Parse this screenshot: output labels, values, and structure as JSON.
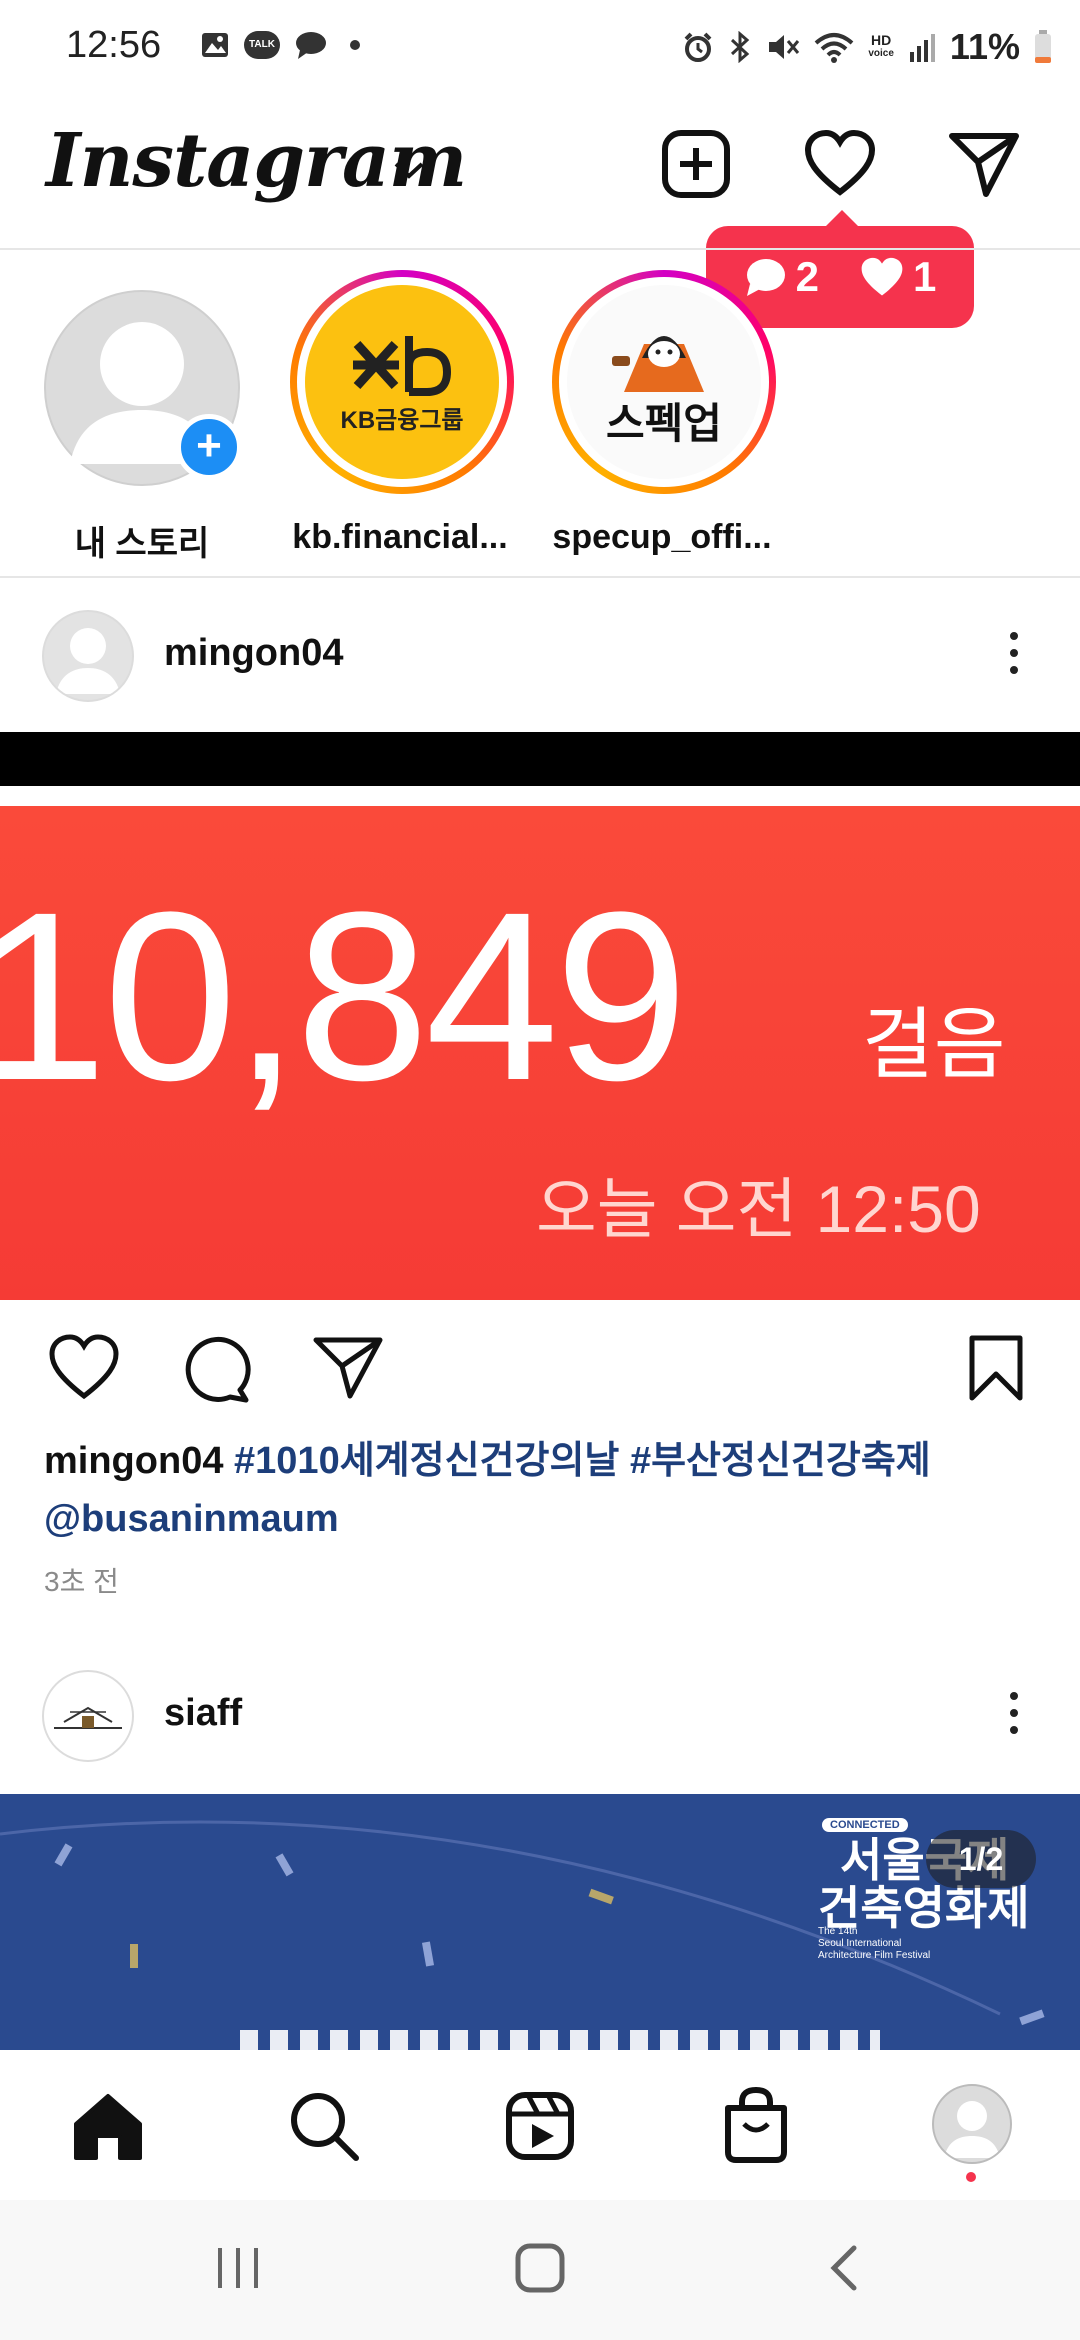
{
  "status": {
    "time": "12:56",
    "hd_label": "HD",
    "voice_label": "voice",
    "battery": "11%",
    "talk_label": "TALK"
  },
  "header": {
    "logo": "Instagram",
    "icons": [
      "new-post-icon",
      "heart-icon",
      "direct-message-icon"
    ]
  },
  "notification": {
    "comments": "2",
    "likes": "1"
  },
  "stories": [
    {
      "label": "내 스토리"
    },
    {
      "label": "kb.financial...",
      "logo_text": "KB금융그룹"
    },
    {
      "label": "specup_offi...",
      "logo_text": "스펙업"
    }
  ],
  "post1": {
    "username": "mingon04",
    "image": {
      "steps": "10,849",
      "unit": "걸음",
      "timestamp": "오늘 오전 12:50"
    },
    "caption_user": "mingon04",
    "caption_tags": "#1010세계정신건강의날 #부산정신건강축제",
    "caption_mention": "@busaninmaum",
    "time_ago": "3초 전"
  },
  "post2": {
    "username": "siaff",
    "image": {
      "badge": "CONNECTED",
      "title_line1": "서울국제",
      "title_line2": "건축영화제",
      "sub1": "The 14th",
      "sub2": "Seoul International",
      "sub3": "Architecture Film Festival",
      "page_indicator": "1/2"
    }
  },
  "bottom_nav": [
    "home-icon",
    "search-icon",
    "reels-icon",
    "shop-icon",
    "profile-avatar"
  ],
  "colors": {
    "notification": "#f5334d",
    "story_add": "#1c8ef5",
    "tag_blue": "#1d3e7a",
    "step_bg": "#f53b35",
    "siaff_bg": "#2a4a8f"
  }
}
